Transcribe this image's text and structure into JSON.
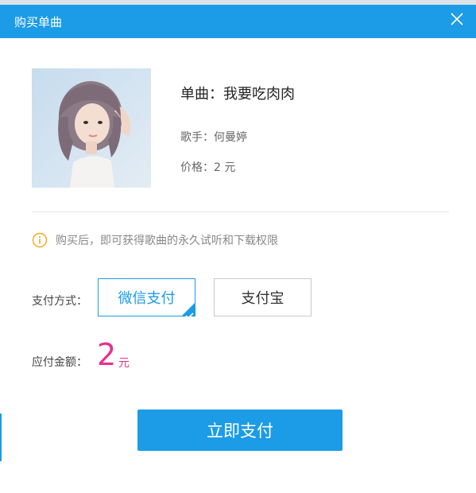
{
  "dialog": {
    "title": "购买单曲"
  },
  "song": {
    "title": "单曲：我要吃肉肉",
    "singer": "歌手：何曼婷",
    "price": "价格：2 元"
  },
  "notice": "购买后，即可获得歌曲的永久试听和下载权限",
  "payment": {
    "label": "支付方式：",
    "options": [
      "微信支付",
      "支付宝"
    ],
    "selected": "微信支付"
  },
  "amount": {
    "label": "应付金额：",
    "value": "2",
    "unit": "元"
  },
  "pay_button_label": "立即支付",
  "colors": {
    "accent": "#1c9be6",
    "price": "#e8318e"
  },
  "icons": {
    "close": "close-icon",
    "info": "info-icon",
    "check": "check-icon"
  }
}
